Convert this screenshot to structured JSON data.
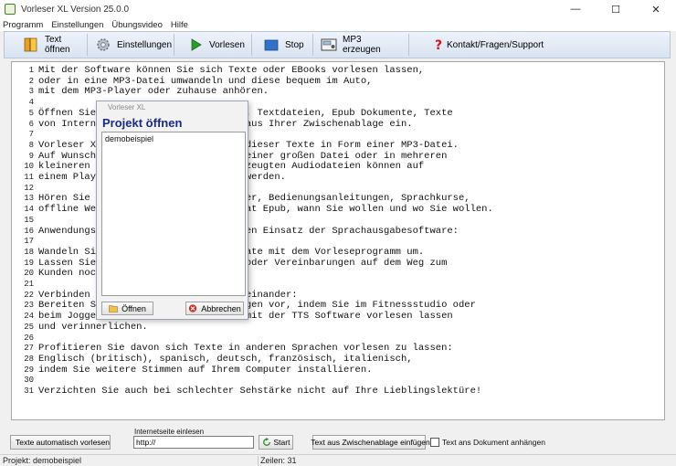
{
  "window": {
    "title": "Vorleser XL Version 25.0.0",
    "controls": {
      "minimize": "—",
      "maximize": "☐",
      "close": "✕"
    }
  },
  "menu": [
    "Programm",
    "Einstellungen",
    "Übungsvideo",
    "Hilfe"
  ],
  "toolbar": {
    "open": "Text öffnen",
    "settings": "Einstellungen",
    "read": "Vorlesen",
    "stop": "Stop",
    "mp3": "MP3 erzeugen",
    "contact": "Kontakt/Fragen/Support"
  },
  "editor": {
    "lines": [
      {
        "n": "1",
        "t": "Mit der Software können Sie sich Texte oder EBooks vorlesen lassen,"
      },
      {
        "n": "2",
        "t": "oder in eine MP3-Datei umwandeln und diese bequem im Auto,"
      },
      {
        "n": "3",
        "t": "mit dem MP3-Player oder zuhause anhören."
      },
      {
        "n": "4",
        "t": ""
      },
      {
        "n": "5",
        "t": "Öffnen Sie                          , Textdateien, Epub Dokumente, Texte"
      },
      {
        "n": "6",
        "t": "von Intern                          aus Ihrer Zwischenablage ein."
      },
      {
        "n": "7",
        "t": ""
      },
      {
        "n": "8",
        "t": "Vorleser X                          dieser Texte in Form einer MP3-Datei."
      },
      {
        "n": "9",
        "t": "Auf Wunsch                          einer großen Datei oder in mehreren"
      },
      {
        "n": "10",
        "t": "kleineren                           zeugten Audiodateien können auf"
      },
      {
        "n": "11",
        "t": "einem Play                          werden."
      },
      {
        "n": "12",
        "t": ""
      },
      {
        "n": "13",
        "t": "Hören Sie                           er, Bedienungsanleitungen, Sprachkurse,"
      },
      {
        "n": "14",
        "t": "offline We                          at Epub, wann Sie wollen und wo Sie wollen."
      },
      {
        "n": "15",
        "t": ""
      },
      {
        "n": "16",
        "t": "Anwendungs                          en Einsatz der Sprachausgabesoftware:"
      },
      {
        "n": "17",
        "t": ""
      },
      {
        "n": "18",
        "t": "Wandeln Si                          ate mit dem Vorleseprogramm um."
      },
      {
        "n": "19",
        "t": "Lassen Sie                          oder Vereinbarungen auf dem Weg zum"
      },
      {
        "n": "20",
        "t": "Kunden noc"
      },
      {
        "n": "21",
        "t": ""
      },
      {
        "n": "22",
        "t": "Verbinden                           einander:"
      },
      {
        "n": "23",
        "t": "Bereiten S                          gen vor, indem Sie im Fitnessstudio oder"
      },
      {
        "n": "24",
        "t": "beim Jogge                          mit der TTS Software vorlesen lassen"
      },
      {
        "n": "25",
        "t": "und verinnerlichen."
      },
      {
        "n": "26",
        "t": ""
      },
      {
        "n": "27",
        "t": "Profitieren Sie davon sich Texte in anderen Sprachen vorlesen zu lassen:"
      },
      {
        "n": "28",
        "t": "Englisch (britisch), spanisch, deutsch, französisch, italienisch,"
      },
      {
        "n": "29",
        "t": "indem Sie weitere Stimmen auf Ihrem Computer installieren."
      },
      {
        "n": "30",
        "t": ""
      },
      {
        "n": "31",
        "t": "Verzichten Sie auch bei schlechter Sehstärke nicht auf Ihre Lieblingslektüre!"
      }
    ]
  },
  "dialog": {
    "caption": "Vorleser XL",
    "title": "Projekt öffnen",
    "items": [
      "demobeispiel"
    ],
    "open_button": "Öffnen",
    "cancel_button": "Abbrechen"
  },
  "bottom": {
    "auto_read_button": "Texte automatisch vorlesen",
    "web_label": "Internetseite einlesen",
    "url_value": "http://",
    "start_button": "Start",
    "clipboard_button": "Text aus Zwischenablage einfügen",
    "append_label": "Text ans Dokument anhängen",
    "append_checked": false
  },
  "status": {
    "project": "Projekt: demobeispiel",
    "lines": "Zeilen: 31"
  },
  "colors": {
    "dialog_title": "#1a2a88",
    "toolbar_top": "#eef3fb",
    "toolbar_bottom": "#d9e3f1",
    "stop_icon": "#2f72c8",
    "contact_icon": "#d01818",
    "read_icon": "#2a9a2a"
  }
}
